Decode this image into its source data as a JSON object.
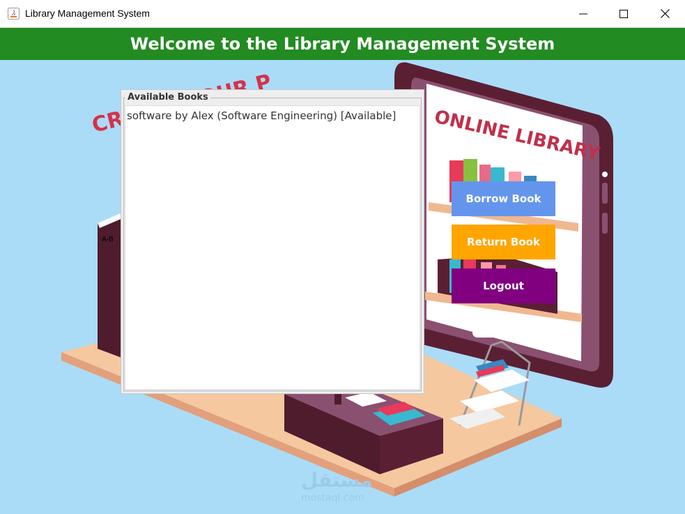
{
  "window": {
    "title": "Library Management System",
    "controls": {
      "minimize_icon": "minimize-icon",
      "maximize_icon": "maximize-icon",
      "close_icon": "close-icon"
    }
  },
  "header": {
    "title": "Welcome to the Library Management System",
    "background": "#228b22"
  },
  "background_art": {
    "banner_text": "CREATE YOUR P",
    "tablet_text": "ONLINE LIBRARY",
    "shelf_label": "A-B",
    "watermark_arabic": "مستقل",
    "watermark_latin": "mostaql.com"
  },
  "books_panel": {
    "title": "Available Books",
    "items": [
      "software by Alex (Software Engineering) [Available]"
    ]
  },
  "actions": {
    "borrow": {
      "label": "Borrow Book",
      "color": "#6495ed"
    },
    "return": {
      "label": "Return Book",
      "color": "#ffa500"
    },
    "logout": {
      "label": "Logout",
      "color": "#800080"
    }
  }
}
